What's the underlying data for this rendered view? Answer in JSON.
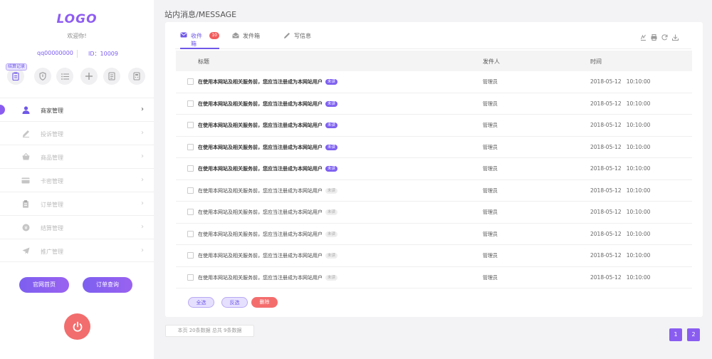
{
  "sidebar": {
    "logo": "LOGO",
    "welcome": "欢迎你!",
    "username": "qq00000000",
    "user_id": "ID：10009",
    "quick_tooltip": "结算记录",
    "quick_icons": [
      "clipboard-icon",
      "shield-icon",
      "list-icon",
      "plus-icon",
      "document-icon",
      "calculator-icon"
    ],
    "menu": [
      {
        "label": "商家管理",
        "icon": "user-icon",
        "active": true
      },
      {
        "label": "投诉管理",
        "icon": "edit-icon",
        "active": false
      },
      {
        "label": "商品管理",
        "icon": "basket-icon",
        "active": false
      },
      {
        "label": "卡密管理",
        "icon": "card-icon",
        "active": false
      },
      {
        "label": "订单管理",
        "icon": "order-icon",
        "active": false
      },
      {
        "label": "结算管理",
        "icon": "coin-icon",
        "active": false
      },
      {
        "label": "推广管理",
        "icon": "send-icon",
        "active": false
      }
    ],
    "buttons": {
      "home": "官网首页",
      "order_query": "订单查询"
    }
  },
  "main": {
    "title": "站内消息/MESSAGE",
    "tabs": [
      {
        "label": "收件箱",
        "icon": "inbox-icon",
        "badge": "10",
        "active": true
      },
      {
        "label": "发件箱",
        "icon": "outbox-icon",
        "active": false
      },
      {
        "label": "写信息",
        "icon": "pen-icon",
        "active": false
      }
    ],
    "toolbar_icons": [
      "columns-icon",
      "print-icon",
      "refresh-icon",
      "download-icon"
    ],
    "table": {
      "headers": {
        "title": "标题",
        "sender": "发件人",
        "time": "时间"
      },
      "rows": [
        {
          "title": "在使用本网站及相关服务前，您应当注册成为本网站用户",
          "status": "未读",
          "sender": "管理员",
          "time": "2018-05-12   10:10:00",
          "unread": true
        },
        {
          "title": "在使用本网站及相关服务前，您应当注册成为本网站用户",
          "status": "未读",
          "sender": "管理员",
          "time": "2018-05-12   10:10:00",
          "unread": true
        },
        {
          "title": "在使用本网站及相关服务前，您应当注册成为本网站用户",
          "status": "未读",
          "sender": "管理员",
          "time": "2018-05-12   10:10:00",
          "unread": true
        },
        {
          "title": "在使用本网站及相关服务前，您应当注册成为本网站用户",
          "status": "未读",
          "sender": "管理员",
          "time": "2018-05-12   10:10:00",
          "unread": true
        },
        {
          "title": "在使用本网站及相关服务前，您应当注册成为本网站用户",
          "status": "未读",
          "sender": "管理员",
          "time": "2018-05-12   10:10:00",
          "unread": true
        },
        {
          "title": "在使用本网站及相关服务前，您应当注册成为本网站用户",
          "status": "未读",
          "sender": "管理员",
          "time": "2018-05-12   10:10:00",
          "unread": false
        },
        {
          "title": "在使用本网站及相关服务前，您应当注册成为本网站用户",
          "status": "未读",
          "sender": "管理员",
          "time": "2018-05-12   10:10:00",
          "unread": false
        },
        {
          "title": "在使用本网站及相关服务前，您应当注册成为本网站用户",
          "status": "未读",
          "sender": "管理员",
          "time": "2018-05-12   10:10:00",
          "unread": false
        },
        {
          "title": "在使用本网站及相关服务前，您应当注册成为本网站用户",
          "status": "未读",
          "sender": "管理员",
          "time": "2018-05-12   10:10:00",
          "unread": false
        },
        {
          "title": "在使用本网站及相关服务前，您应当注册成为本网站用户",
          "status": "未读",
          "sender": "管理员",
          "time": "2018-05-12   10:10:00",
          "unread": false
        }
      ]
    },
    "actions": {
      "select_all": "全选",
      "invert": "反选",
      "delete": "删除"
    },
    "pagination": {
      "info": "本页  20条数据  总共  9条数据",
      "pages": [
        "1",
        "2"
      ]
    }
  },
  "colors": {
    "accent": "#7d5ff0",
    "danger": "#f26d6d",
    "background": "#f3f3f6"
  }
}
